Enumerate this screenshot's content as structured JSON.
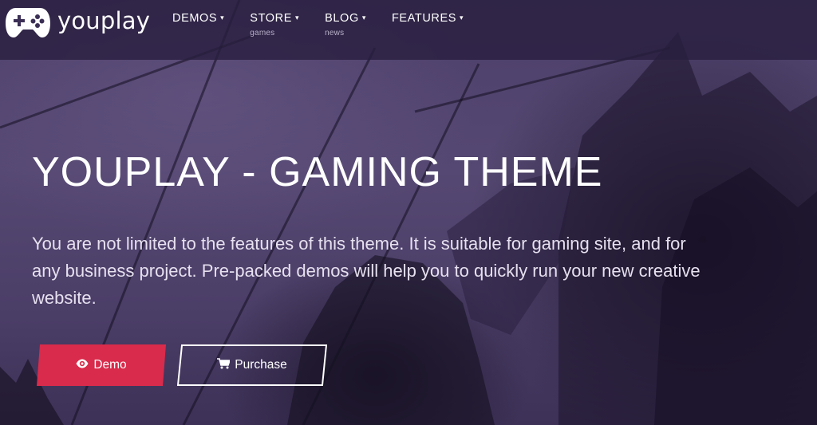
{
  "brand": {
    "name": "youplay",
    "logo_icon": "gamepad-icon"
  },
  "nav": {
    "items": [
      {
        "label": "DEMOS",
        "sub": ""
      },
      {
        "label": "STORE",
        "sub": "games"
      },
      {
        "label": "BLOG",
        "sub": "news"
      },
      {
        "label": "FEATURES",
        "sub": ""
      }
    ],
    "caret": "▾"
  },
  "hero": {
    "title": "YOUPLAY - GAMING THEME",
    "text": "You are not limited to the features of this theme. It is suitable for gaming site, and for any business project. Pre-packed demos will help you to quickly run your new creative website."
  },
  "buttons": {
    "demo": {
      "label": "Demo",
      "icon": "eye-icon",
      "color": "#d92b4b"
    },
    "purchase": {
      "label": "Purchase",
      "icon": "shopping-cart-icon"
    }
  }
}
